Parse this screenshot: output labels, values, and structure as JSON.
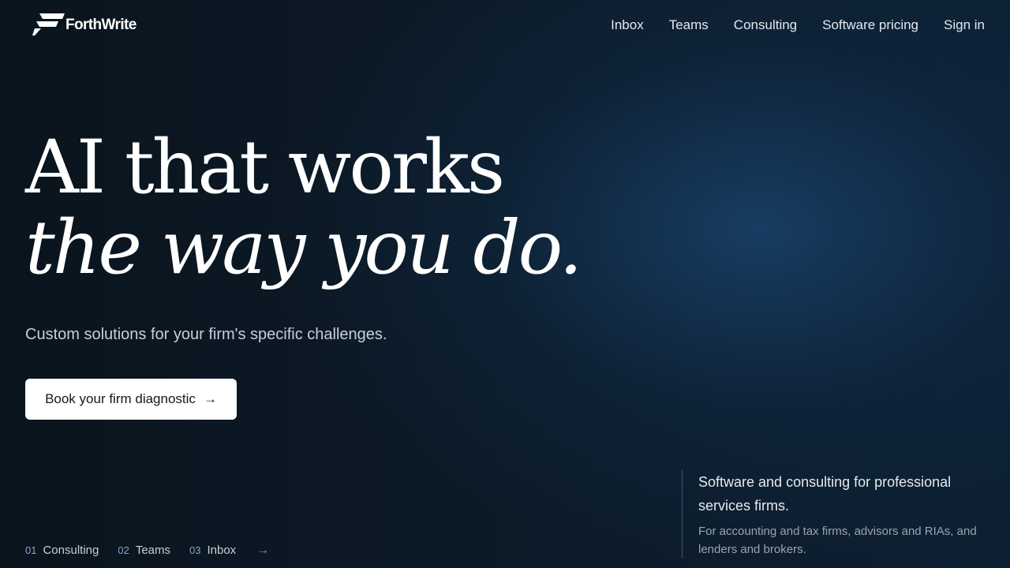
{
  "brand": {
    "name": "ForthWrite",
    "logo_icon": "forthwrite-logo-icon"
  },
  "nav": {
    "items": [
      {
        "label": "Inbox"
      },
      {
        "label": "Teams"
      },
      {
        "label": "Consulting"
      },
      {
        "label": "Software pricing"
      },
      {
        "label": "Sign in"
      }
    ]
  },
  "hero": {
    "title_line1": "AI that works",
    "title_line2": "the way you do.",
    "subtitle": "Custom solutions for your firm's specific challenges.",
    "cta_label": "Book your firm diagnostic",
    "cta_icon": "arrow-right-icon"
  },
  "steps": {
    "items": [
      {
        "number": "01",
        "label": "Consulting"
      },
      {
        "number": "02",
        "label": "Teams"
      },
      {
        "number": "03",
        "label": "Inbox"
      }
    ],
    "arrow_icon": "arrow-right-icon"
  },
  "side_panel": {
    "title": "Software and consulting for professional services firms.",
    "text": "For accounting and tax firms, advisors and RIAs, and lenders and brokers."
  },
  "colors": {
    "background": "#0a141d",
    "glow": "#1c4876",
    "cta_background": "#ffffff",
    "accent_number": "#7ea6cf"
  }
}
